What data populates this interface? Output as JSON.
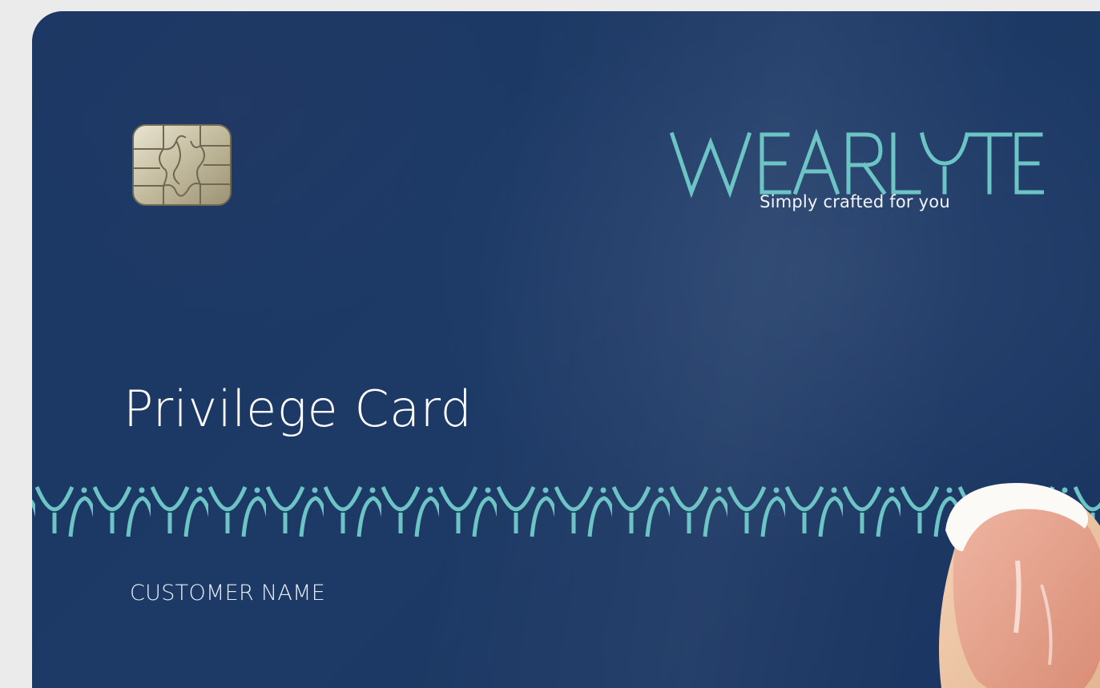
{
  "card": {
    "brand_name": "WEARLYTE",
    "tagline": "Simply crafted for you",
    "title": "Privilege Card",
    "name_label": "CUSTOMER NAME"
  },
  "colors": {
    "card_background": "#1b3763",
    "accent_teal": "#6dc4c4",
    "page_background": "#ebebeb",
    "chip_gold": "#c9c0a4"
  },
  "icons": {
    "chip": "emv-chip-icon",
    "decoration": "teal-wave-pattern"
  }
}
